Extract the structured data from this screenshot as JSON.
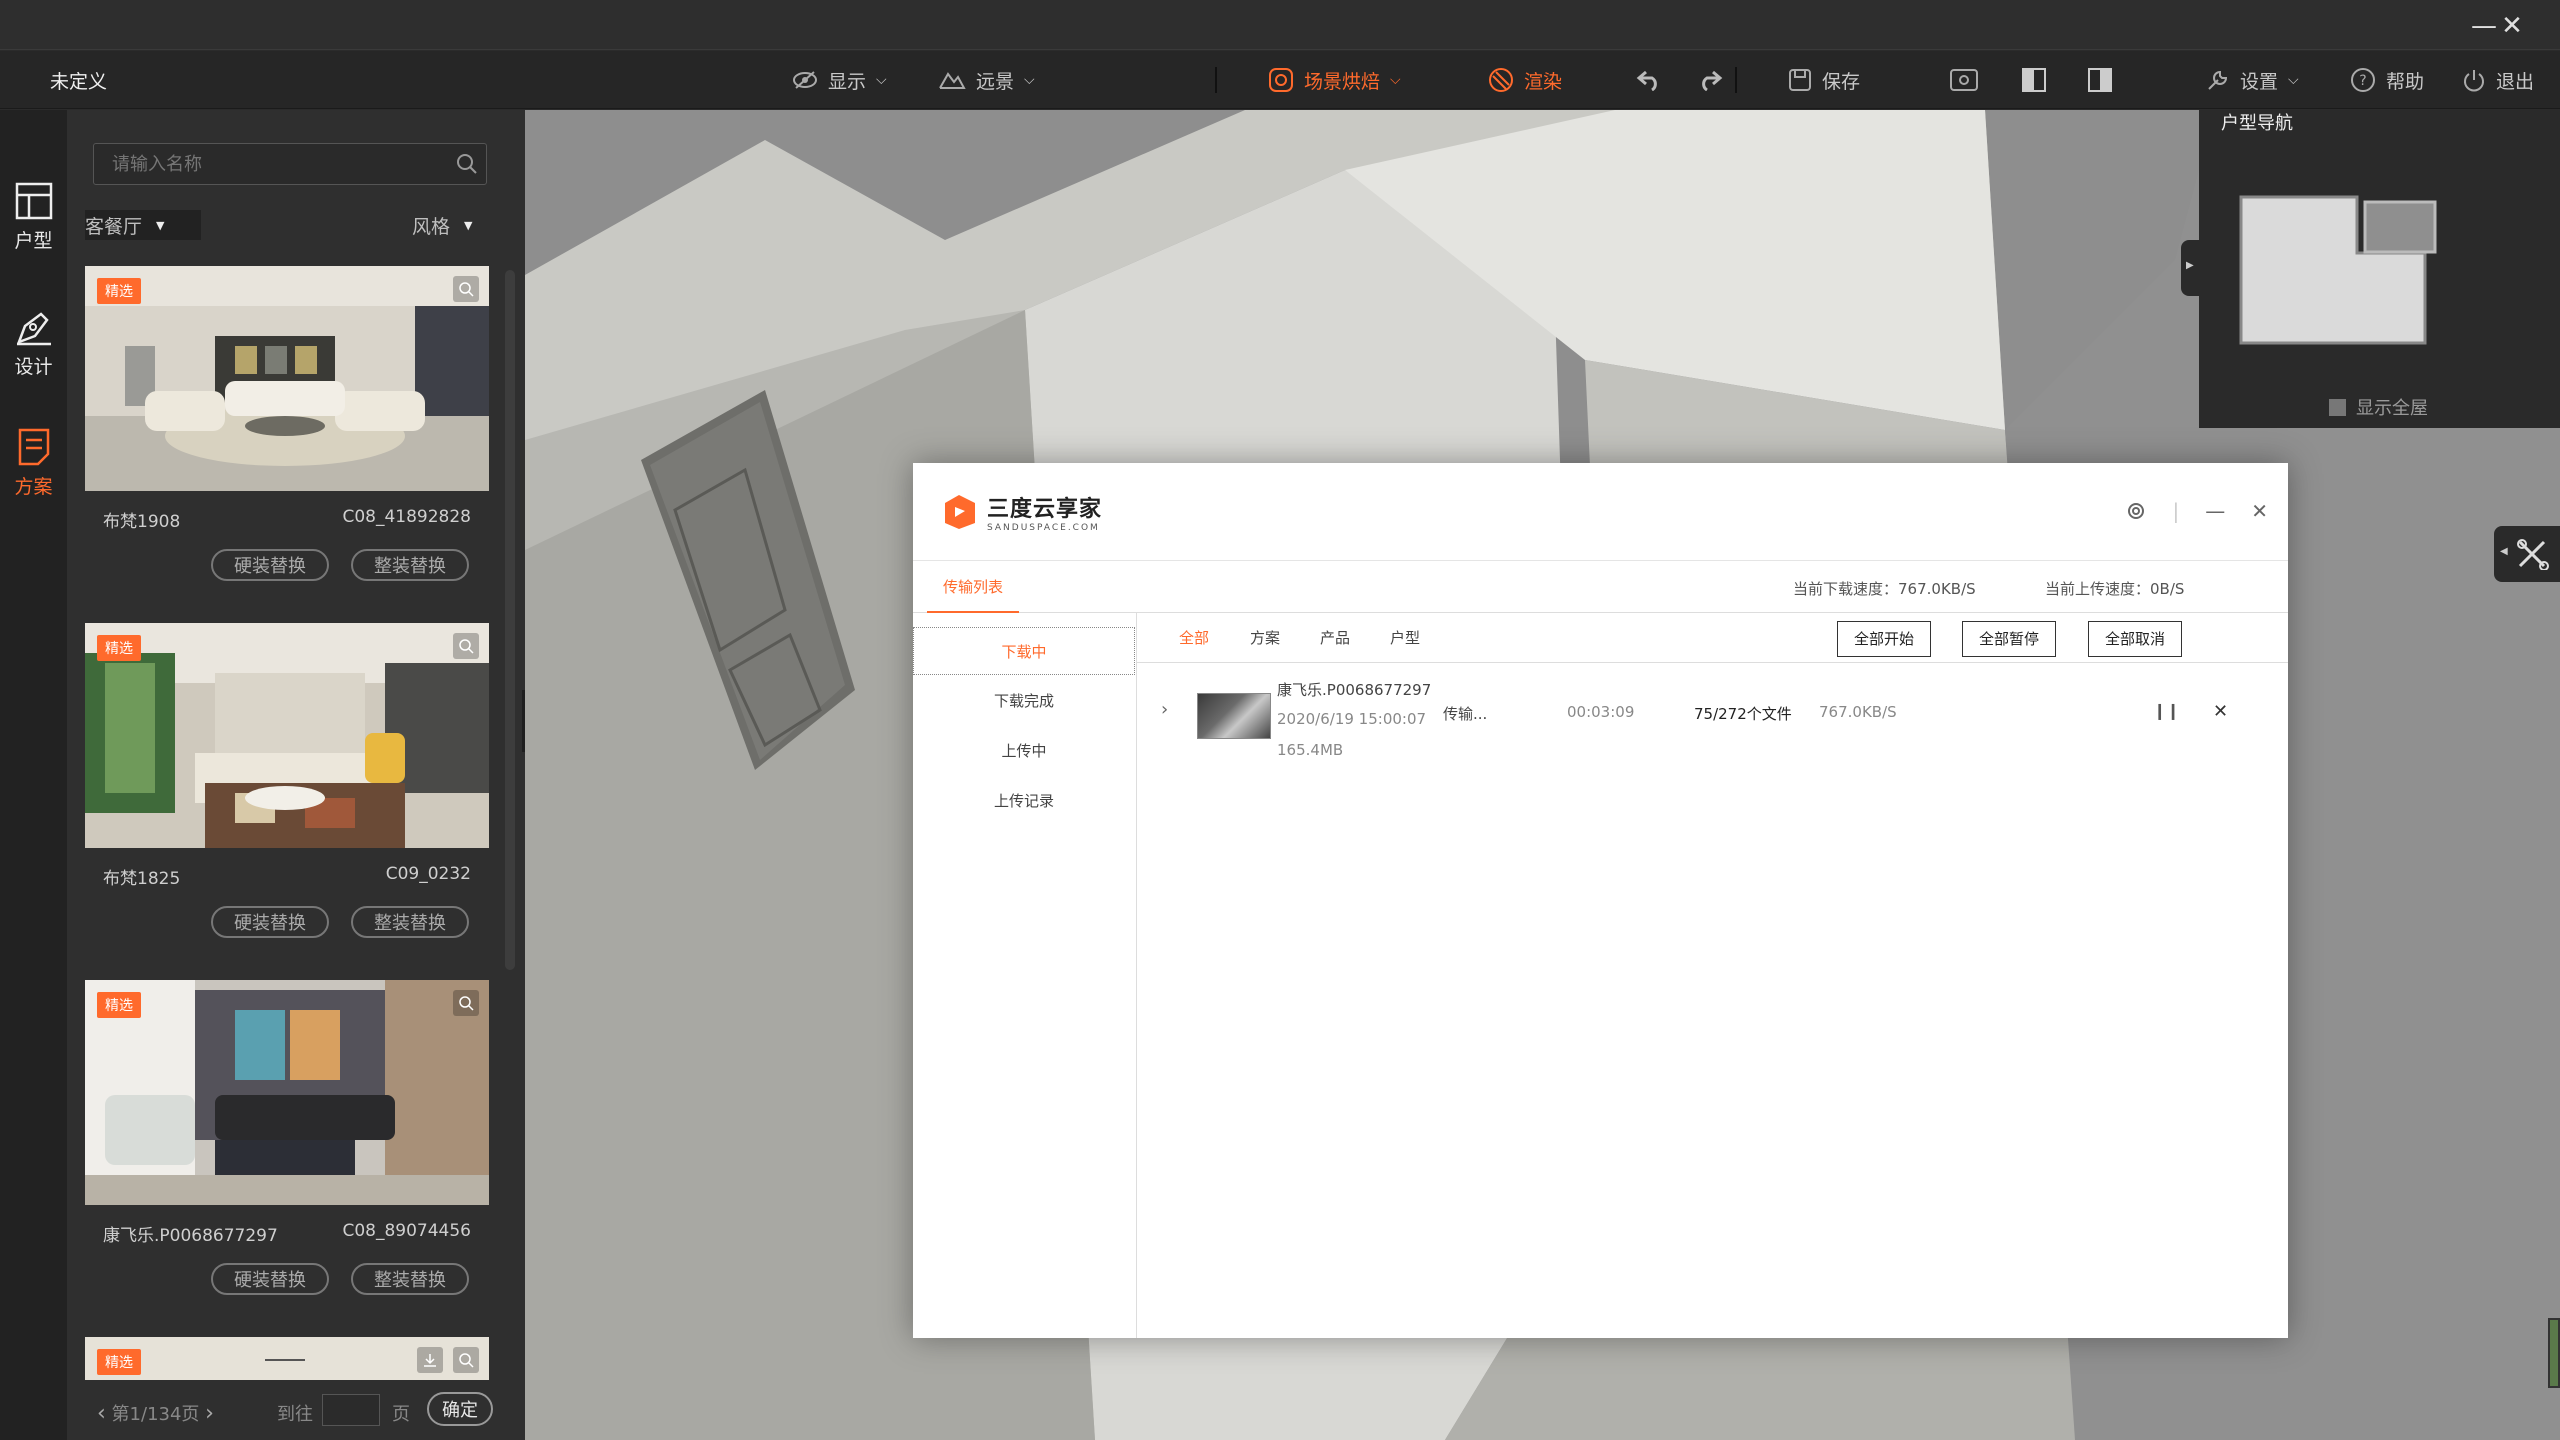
{
  "app": {
    "doc_title": "未定义",
    "window_controls": {
      "minimize": "—",
      "close": "✕"
    }
  },
  "toolbar": {
    "display": "显示",
    "distant": "远景",
    "bake": "场景烘焙",
    "render": "渲染",
    "save": "保存",
    "settings": "设置",
    "help": "帮助",
    "exit": "退出"
  },
  "leftnav": [
    {
      "label": "户型",
      "icon": "floorplan-icon"
    },
    {
      "label": "设计",
      "icon": "pen-icon"
    },
    {
      "label": "方案",
      "icon": "document-icon"
    }
  ],
  "panel": {
    "search_placeholder": "请输入名称",
    "room_filter": "客餐厅",
    "style_filter": "风格",
    "badge": "精选",
    "btn_hard": "硬装替换",
    "btn_full": "整装替换",
    "cards": [
      {
        "name": "布梵1908",
        "code": "C08_41892828"
      },
      {
        "name": "布梵1825",
        "code": "C09_0232"
      },
      {
        "name": "康飞乐.P0068677297",
        "code": "C08_89074456"
      }
    ],
    "pager": {
      "page": "第1/134页",
      "goto": "到往",
      "unit": "页",
      "ok": "确定"
    }
  },
  "minimap": {
    "title": "户型导航",
    "show_all": "显示全屋"
  },
  "dialog": {
    "brand": "三度云享家",
    "brand_sub": "SANDUSPACE.COM",
    "tab": "传输列表",
    "download_speed": "当前下载速度：767.0KB/S",
    "upload_speed": "当前上传速度：0B/S",
    "side": [
      "下载中",
      "下载完成",
      "上传中",
      "上传记录"
    ],
    "filters": [
      "全部",
      "方案",
      "产品",
      "户型"
    ],
    "actions": [
      "全部开始",
      "全部暂停",
      "全部取消"
    ],
    "task": {
      "name": "康飞乐.P0068677297",
      "date": "2020/6/19 15:00:07",
      "size": "165.4MB",
      "status": "传输...",
      "elapsed": "00:03:09",
      "files": "75/272个文件",
      "speed": "767.0KB/S"
    }
  },
  "colors": {
    "accent": "#ff6a2c",
    "toolbar_bg": "#262626",
    "panel_bg": "#2f2f2f",
    "viewport_bg": "#8c8c8c"
  }
}
